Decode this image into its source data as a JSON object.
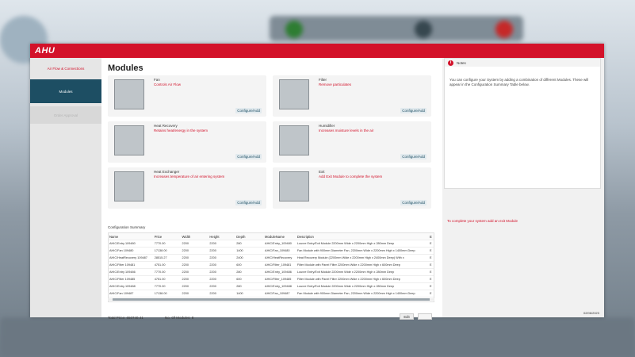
{
  "app": {
    "logo": "AHU"
  },
  "nav": {
    "items": [
      {
        "label": "Air Flow & Connections"
      },
      {
        "label": "Modules"
      },
      {
        "label": "Order Approval"
      }
    ]
  },
  "main": {
    "title": "Modules",
    "cards": [
      {
        "name": "Fan",
        "desc": "Controls Air Flow",
        "btn": "Configure/Add"
      },
      {
        "name": "Filter",
        "desc": "Remove particulates",
        "btn": "Configure/Add"
      },
      {
        "name": "Heat Recovery",
        "desc": "Retains heat/energy in the system",
        "btn": "Configure/Add"
      },
      {
        "name": "Humidifier",
        "desc": "Increases moisture levels in the air",
        "btn": "Configure/Add"
      },
      {
        "name": "Heat Exchanger",
        "desc": "Increases temperature of air entering system",
        "btn": "Configure/Add"
      },
      {
        "name": "Exit",
        "desc": "Add Exit Module to complete the system",
        "btn": "Configure/Add"
      }
    ],
    "summary_title": "Configuration Summary",
    "table": {
      "headers": [
        "Name",
        "Price",
        "Width",
        "Height",
        "Depth",
        "ModuleName",
        "Description",
        "E"
      ],
      "rows": [
        [
          "AHIC/Entry 109480",
          "7770.00",
          "2200",
          "2200",
          "280",
          "AHIC/Entry_109480",
          "Louvre Entry/Exit Module 2200mm Wide x 2200mm High x 280mm Deep",
          "E"
        ],
        [
          "AHIC/Fan 109480",
          "17138.00",
          "2200",
          "2200",
          "1400",
          "AHIC/Fan_109480",
          "Fan Module with 900mm Diameter Fan, 2200mm Wide x 2200mm High x 1400mm Deep",
          "E"
        ],
        [
          "AHIC/HeatRecovery 109487",
          "28515.27",
          "2200",
          "2200",
          "2400",
          "AHIC/HeatRecovery",
          "Heat Recovery Module (2200mm Wide x 2200mm High x 2400mm Deep) With x",
          "E"
        ],
        [
          "AHIC/Filter 109481",
          "4751.00",
          "2200",
          "2200",
          "600",
          "AHIC/Filter_109481",
          "Filter Module with Panel Filter 2200mm Wide x 2200mm High x 600mm Deep",
          "E"
        ],
        [
          "AHIC/Entry 109486",
          "7770.00",
          "2200",
          "2200",
          "280",
          "AHIC/Entry_109486",
          "Louvre Entry/Exit Module 2200mm Wide x 2200mm High x 280mm Deep",
          "E"
        ],
        [
          "AHIC/Filter 109485",
          "4751.00",
          "2200",
          "2200",
          "600",
          "AHIC/Filter_109485",
          "Filter Module with Panel Filter 2200mm Wide x 2200mm High x 600mm Deep",
          "E"
        ],
        [
          "AHIC/Entry 109488",
          "7770.00",
          "2200",
          "2200",
          "280",
          "AHIC/Entry_109488",
          "Louvre Entry/Exit Module 2200mm Wide x 2200mm High x 280mm Deep",
          "E"
        ],
        [
          "AHIC/Fan 109487",
          "17138.00",
          "2200",
          "2200",
          "1400",
          "AHIC/Fan_109487",
          "Fan Module with 900mm Diameter Fan, 2200mm Wide x 2200mm High x 1400mm Deep",
          "E"
        ]
      ]
    },
    "total_price": "Total Price: 650740.41",
    "module_count": "No. Of Modules: 8",
    "edit_label": "Edit"
  },
  "notes": {
    "title": "Notes",
    "icon": "i",
    "body": "You can configure your System by adding a combination of different Modules. These will appear in the Configuration Summary Table below."
  },
  "hint": "To complete your system add an exit Module",
  "date": "02/06/2023"
}
